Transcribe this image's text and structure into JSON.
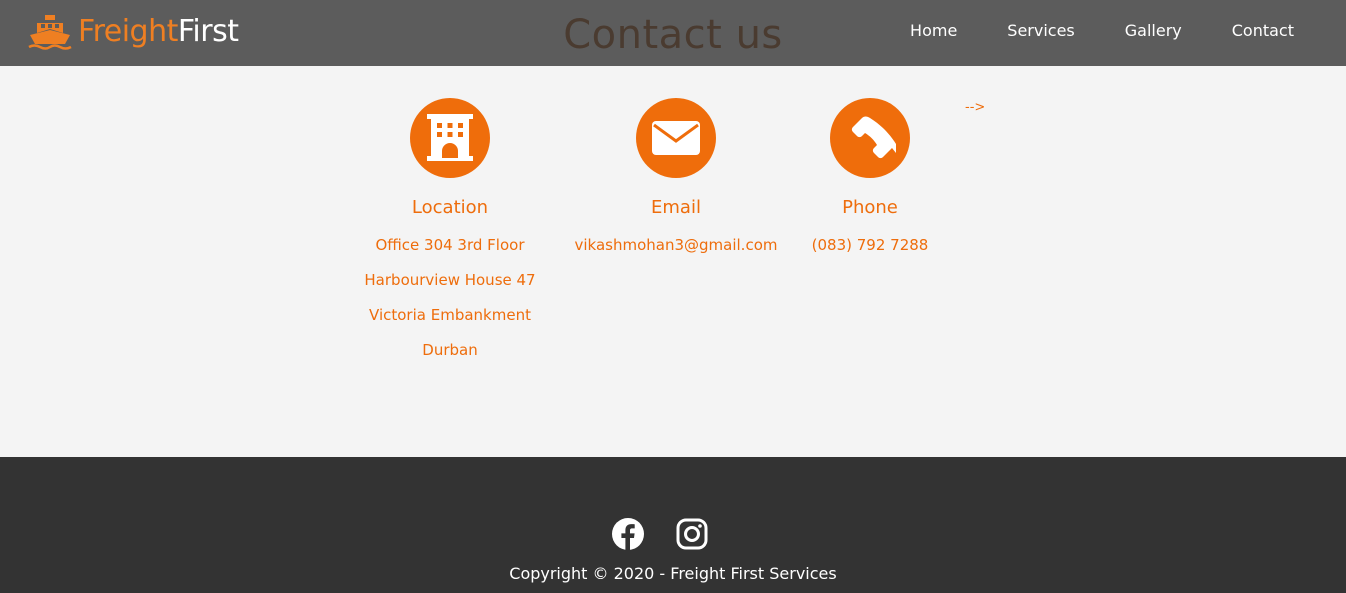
{
  "brand": {
    "part1": "Freight",
    "part2": "First",
    "icon": "ship-icon",
    "color": "#ef7f22"
  },
  "page_title": "Contact us",
  "nav": {
    "items": [
      "Home",
      "Services",
      "Gallery",
      "Contact"
    ]
  },
  "cards": {
    "location": {
      "icon": "building-icon",
      "title": "Location",
      "lines": [
        "Office 304 3rd Floor",
        "Harbourview House 47",
        "Victoria Embankment",
        "Durban"
      ]
    },
    "email": {
      "icon": "envelope-icon",
      "title": "Email",
      "lines": [
        "vikashmohan3@gmail.com"
      ]
    },
    "phone": {
      "icon": "phone-icon",
      "title": "Phone",
      "lines": [
        "(083) 792 7288"
      ]
    }
  },
  "stray_text": "-->",
  "footer": {
    "social": [
      "facebook-icon",
      "instagram-icon"
    ],
    "copyright": "Copyright © 2020 - Freight First Services"
  },
  "colors": {
    "accent": "#ef6d0b",
    "navbar": "#5c5c5c",
    "footer": "#333333",
    "background": "#f4f4f4"
  }
}
